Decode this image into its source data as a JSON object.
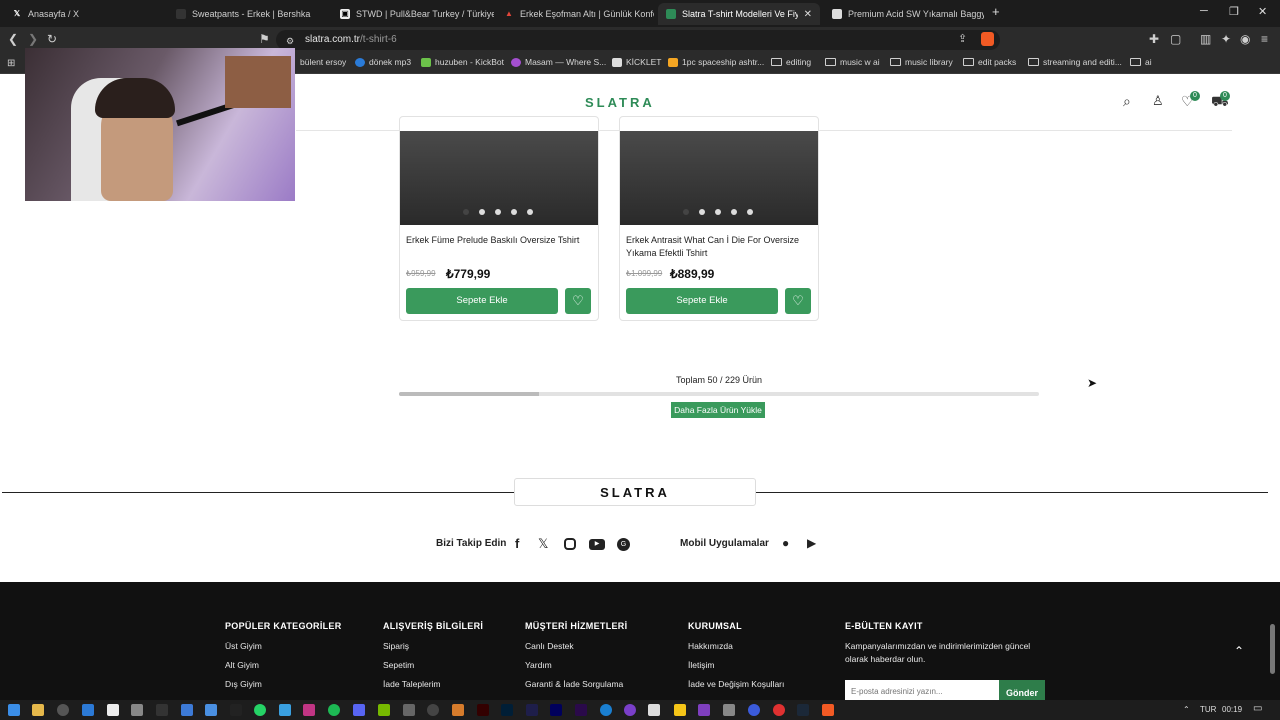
{
  "browser": {
    "tabs": [
      {
        "title": "Anasayfa / X",
        "icon": "x-logo-icon"
      },
      {
        "title": "Sweatpants - Erkek | Bershka",
        "icon": "bershka-icon"
      },
      {
        "title": "STWD | Pull&Bear Turkey / Türkiye",
        "icon": "stwd-icon"
      },
      {
        "title": "Erkek Eşofman Altı | Günlük Konfor |",
        "icon": "brand-icon"
      },
      {
        "title": "Slatra T-shirt Modelleri Ve Fiyatla",
        "icon": "slatra-icon",
        "active": true
      },
      {
        "title": "Premium Acid SW Yıkamalı Baggy Eş",
        "icon": "page-icon"
      }
    ],
    "url_host": "slatra.com.tr",
    "url_path": "/t-shirt-6",
    "bookmarks": [
      "bülent ersoy",
      "dönek mp3",
      "huzuben - KickBot",
      "Masam — Where S...",
      "KİCKLET",
      "1pc spaceship ashtr...",
      "editing",
      "music w ai",
      "music library",
      "edit packs",
      "streaming and editi...",
      "ai"
    ]
  },
  "site": {
    "logo": "SLATRA",
    "wishlist_count": "0",
    "cart_count": "0"
  },
  "products": [
    {
      "title": "Erkek Füme Prelude Baskılı Oversize Tshirt",
      "old_price": "₺959,99",
      "price": "₺779,99",
      "cart_label": "Sepete Ekle"
    },
    {
      "title": "Erkek Antrasit What Can İ Die For Oversize Yıkama Efektli Tshirt",
      "old_price": "₺1.099,99",
      "price": "₺889,99",
      "cart_label": "Sepete Ekle"
    }
  ],
  "pagination": {
    "summary": "Toplam 50 / 229 Ürün",
    "progress": 0.218,
    "load_more": "Daha Fazla Ürün Yükle"
  },
  "footer": {
    "logo": "SLATRA",
    "follow_label": "Bizi Takip Edin",
    "apps_label": "Mobil Uygulamalar",
    "columns": [
      {
        "head": "POPÜLER KATEGORİLER",
        "links": [
          "Üst Giyim",
          "Alt Giyim",
          "Dış Giyim"
        ]
      },
      {
        "head": "ALIŞVERİŞ BİLGİLERİ",
        "links": [
          "Sipariş",
          "Sepetim",
          "İade Taleplerim"
        ]
      },
      {
        "head": "MÜŞTERİ HİZMETLERİ",
        "links": [
          "Canlı Destek",
          "Yardım",
          "Garanti & İade Sorgulama"
        ]
      },
      {
        "head": "KURUMSAL",
        "links": [
          "Hakkımızda",
          "İletişim",
          "İade ve Değişim Koşulları"
        ]
      }
    ],
    "newsletter": {
      "head": "E-BÜLTEN KAYIT",
      "text": "Kampanyalarımızdan ve indirimlerimizden güncel olarak haberdar olun.",
      "placeholder": "E-posta adresinizi yazın...",
      "button": "Gönder"
    }
  },
  "taskbar": {
    "language": "TUR",
    "time": "00:19"
  },
  "colors": {
    "brand_green": "#2e8b57",
    "button_green": "#3a9a5c"
  }
}
